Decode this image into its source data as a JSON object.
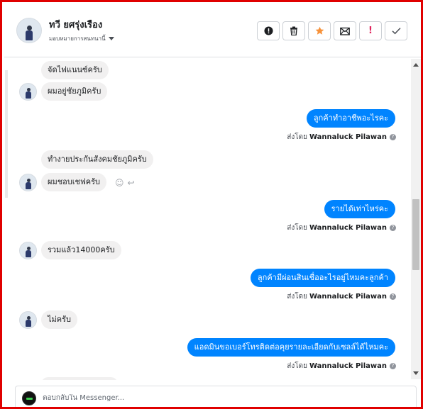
{
  "header": {
    "contact_name": "ทวี ยศรุ่งเรือง",
    "assign_label": "มอบหมายการสนทนานี้"
  },
  "toolbar": [
    {
      "name": "mark-spam-button",
      "icon": "alert-circle-icon",
      "glyph": "!"
    },
    {
      "name": "delete-button",
      "icon": "trash-icon",
      "glyph": "🗑"
    },
    {
      "name": "star-button",
      "icon": "star-icon",
      "glyph": "★",
      "color": "#f7923a"
    },
    {
      "name": "mark-unread-button",
      "icon": "envelope-icon",
      "glyph": "✉"
    },
    {
      "name": "follow-up-button",
      "icon": "exclamation-icon",
      "glyph": "!",
      "color": "#e0245e"
    },
    {
      "name": "mark-done-button",
      "icon": "check-icon",
      "glyph": "✓"
    }
  ],
  "messages": [
    {
      "side": "in",
      "text": "จัดไฟแนนซ์ครับ",
      "avatar": false
    },
    {
      "side": "in",
      "text": "ผมอยู่ชัยภูมิครับ",
      "avatar": true
    },
    {
      "side": "out",
      "text": "ลูกค้าทำอาชีพอะไรคะ"
    },
    {
      "side": "sent_by",
      "prefix": "ส่งโดย",
      "agent": "Wannaluck Pilawan"
    },
    {
      "side": "in",
      "text": "ทำงายประกันสังคมชัยภูมิครับ",
      "avatar": false
    },
    {
      "side": "in",
      "text": "ผมชอบเชฟครับ",
      "avatar": true
    },
    {
      "side": "out",
      "text": "รายได้เท่าไหร่คะ"
    },
    {
      "side": "sent_by",
      "prefix": "ส่งโดย",
      "agent": "Wannaluck Pilawan"
    },
    {
      "side": "in",
      "text": "รวมแล้ว14000ครับ",
      "avatar": true
    },
    {
      "side": "out",
      "text": "ลูกค้ามีผ่อนสินเชื่ออะไรอยู่ไหมคะลูกค้า"
    },
    {
      "side": "sent_by",
      "prefix": "ส่งโดย",
      "agent": "Wannaluck Pilawan"
    },
    {
      "side": "in",
      "text": "ไม่ครับ",
      "avatar": true
    },
    {
      "side": "out",
      "text": "แอดมินขอเบอร์โทรติดต่อคุยรายละเอียดกับเซลล์ได้ไหมคะ"
    },
    {
      "side": "sent_by",
      "prefix": "ส่งโดย",
      "agent": "Wannaluck Pilawan"
    }
  ],
  "composer": {
    "placeholder": "ตอบกลับใน Messenger..."
  },
  "colors": {
    "outgoing_bubble": "#0084ff",
    "incoming_bubble": "#f1f0f0",
    "frame_border": "#e00000"
  }
}
